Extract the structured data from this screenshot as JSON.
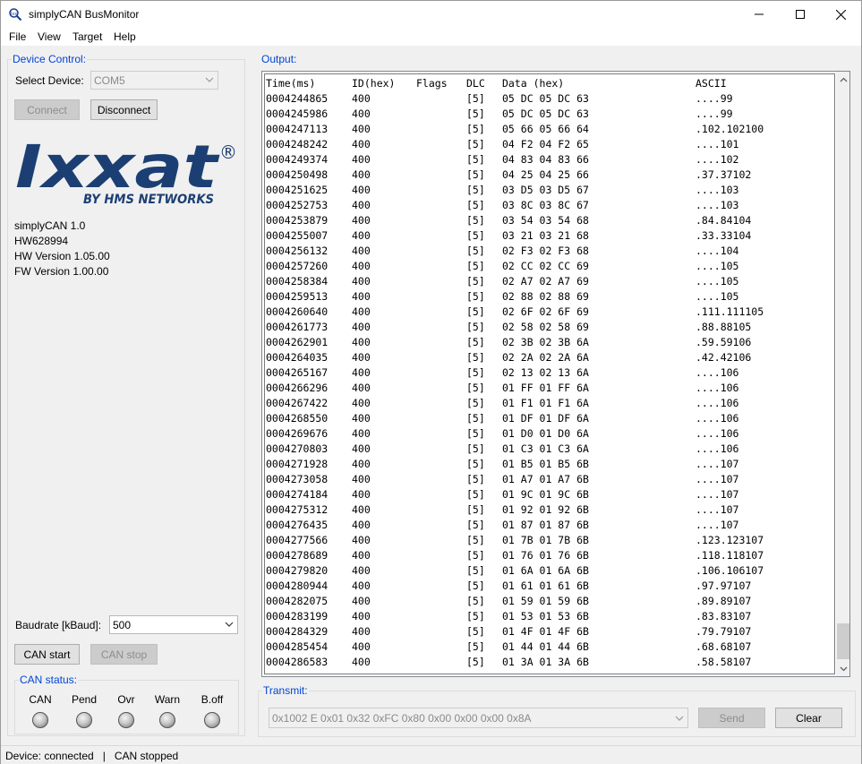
{
  "window": {
    "title": "simplyCAN BusMonitor"
  },
  "menu": [
    "File",
    "View",
    "Target",
    "Help"
  ],
  "device_control": {
    "legend": "Device Control:",
    "select_label": "Select Device:",
    "device_value": "COM5",
    "connect_label": "Connect",
    "disconnect_label": "Disconnect",
    "logo_main": "Ixxat",
    "logo_mark": "®",
    "logo_sub": "BY HMS NETWORKS",
    "info": [
      "simplyCAN 1.0",
      "HW628994",
      "HW Version 1.05.00",
      "FW Version 1.00.00"
    ],
    "baudrate_label": "Baudrate [kBaud]:",
    "baudrate_value": "500",
    "can_start_label": "CAN start",
    "can_stop_label": "CAN stop"
  },
  "can_status": {
    "legend": "CAN status:",
    "leds": [
      "CAN",
      "Pend",
      "Ovr",
      "Warn",
      "B.off"
    ]
  },
  "output": {
    "legend": "Output:",
    "columns": {
      "time": "Time(ms)",
      "id": "ID(hex)",
      "flags": "Flags",
      "dlc": "DLC",
      "data": "Data (hex)",
      "ascii": "ASCII"
    },
    "rows": [
      {
        "time": "0004244865",
        "id": "400",
        "flags": "",
        "dlc": "[5]",
        "data": "05 DC 05 DC 63",
        "ascii": "....99"
      },
      {
        "time": "0004245986",
        "id": "400",
        "flags": "",
        "dlc": "[5]",
        "data": "05 DC 05 DC 63",
        "ascii": "....99"
      },
      {
        "time": "0004247113",
        "id": "400",
        "flags": "",
        "dlc": "[5]",
        "data": "05 66 05 66 64",
        "ascii": ".102.102100"
      },
      {
        "time": "0004248242",
        "id": "400",
        "flags": "",
        "dlc": "[5]",
        "data": "04 F2 04 F2 65",
        "ascii": "....101"
      },
      {
        "time": "0004249374",
        "id": "400",
        "flags": "",
        "dlc": "[5]",
        "data": "04 83 04 83 66",
        "ascii": "....102"
      },
      {
        "time": "0004250498",
        "id": "400",
        "flags": "",
        "dlc": "[5]",
        "data": "04 25 04 25 66",
        "ascii": ".37.37102"
      },
      {
        "time": "0004251625",
        "id": "400",
        "flags": "",
        "dlc": "[5]",
        "data": "03 D5 03 D5 67",
        "ascii": "....103"
      },
      {
        "time": "0004252753",
        "id": "400",
        "flags": "",
        "dlc": "[5]",
        "data": "03 8C 03 8C 67",
        "ascii": "....103"
      },
      {
        "time": "0004253879",
        "id": "400",
        "flags": "",
        "dlc": "[5]",
        "data": "03 54 03 54 68",
        "ascii": ".84.84104"
      },
      {
        "time": "0004255007",
        "id": "400",
        "flags": "",
        "dlc": "[5]",
        "data": "03 21 03 21 68",
        "ascii": ".33.33104"
      },
      {
        "time": "0004256132",
        "id": "400",
        "flags": "",
        "dlc": "[5]",
        "data": "02 F3 02 F3 68",
        "ascii": "....104"
      },
      {
        "time": "0004257260",
        "id": "400",
        "flags": "",
        "dlc": "[5]",
        "data": "02 CC 02 CC 69",
        "ascii": "....105"
      },
      {
        "time": "0004258384",
        "id": "400",
        "flags": "",
        "dlc": "[5]",
        "data": "02 A7 02 A7 69",
        "ascii": "....105"
      },
      {
        "time": "0004259513",
        "id": "400",
        "flags": "",
        "dlc": "[5]",
        "data": "02 88 02 88 69",
        "ascii": "....105"
      },
      {
        "time": "0004260640",
        "id": "400",
        "flags": "",
        "dlc": "[5]",
        "data": "02 6F 02 6F 69",
        "ascii": ".111.111105"
      },
      {
        "time": "0004261773",
        "id": "400",
        "flags": "",
        "dlc": "[5]",
        "data": "02 58 02 58 69",
        "ascii": ".88.88105"
      },
      {
        "time": "0004262901",
        "id": "400",
        "flags": "",
        "dlc": "[5]",
        "data": "02 3B 02 3B 6A",
        "ascii": ".59.59106"
      },
      {
        "time": "0004264035",
        "id": "400",
        "flags": "",
        "dlc": "[5]",
        "data": "02 2A 02 2A 6A",
        "ascii": ".42.42106"
      },
      {
        "time": "0004265167",
        "id": "400",
        "flags": "",
        "dlc": "[5]",
        "data": "02 13 02 13 6A",
        "ascii": "....106"
      },
      {
        "time": "0004266296",
        "id": "400",
        "flags": "",
        "dlc": "[5]",
        "data": "01 FF 01 FF 6A",
        "ascii": "....106"
      },
      {
        "time": "0004267422",
        "id": "400",
        "flags": "",
        "dlc": "[5]",
        "data": "01 F1 01 F1 6A",
        "ascii": "....106"
      },
      {
        "time": "0004268550",
        "id": "400",
        "flags": "",
        "dlc": "[5]",
        "data": "01 DF 01 DF 6A",
        "ascii": "....106"
      },
      {
        "time": "0004269676",
        "id": "400",
        "flags": "",
        "dlc": "[5]",
        "data": "01 D0 01 D0 6A",
        "ascii": "....106"
      },
      {
        "time": "0004270803",
        "id": "400",
        "flags": "",
        "dlc": "[5]",
        "data": "01 C3 01 C3 6A",
        "ascii": "....106"
      },
      {
        "time": "0004271928",
        "id": "400",
        "flags": "",
        "dlc": "[5]",
        "data": "01 B5 01 B5 6B",
        "ascii": "....107"
      },
      {
        "time": "0004273058",
        "id": "400",
        "flags": "",
        "dlc": "[5]",
        "data": "01 A7 01 A7 6B",
        "ascii": "....107"
      },
      {
        "time": "0004274184",
        "id": "400",
        "flags": "",
        "dlc": "[5]",
        "data": "01 9C 01 9C 6B",
        "ascii": "....107"
      },
      {
        "time": "0004275312",
        "id": "400",
        "flags": "",
        "dlc": "[5]",
        "data": "01 92 01 92 6B",
        "ascii": "....107"
      },
      {
        "time": "0004276435",
        "id": "400",
        "flags": "",
        "dlc": "[5]",
        "data": "01 87 01 87 6B",
        "ascii": "....107"
      },
      {
        "time": "0004277566",
        "id": "400",
        "flags": "",
        "dlc": "[5]",
        "data": "01 7B 01 7B 6B",
        "ascii": ".123.123107"
      },
      {
        "time": "0004278689",
        "id": "400",
        "flags": "",
        "dlc": "[5]",
        "data": "01 76 01 76 6B",
        "ascii": ".118.118107"
      },
      {
        "time": "0004279820",
        "id": "400",
        "flags": "",
        "dlc": "[5]",
        "data": "01 6A 01 6A 6B",
        "ascii": ".106.106107"
      },
      {
        "time": "0004280944",
        "id": "400",
        "flags": "",
        "dlc": "[5]",
        "data": "01 61 01 61 6B",
        "ascii": ".97.97107"
      },
      {
        "time": "0004282075",
        "id": "400",
        "flags": "",
        "dlc": "[5]",
        "data": "01 59 01 59 6B",
        "ascii": ".89.89107"
      },
      {
        "time": "0004283199",
        "id": "400",
        "flags": "",
        "dlc": "[5]",
        "data": "01 53 01 53 6B",
        "ascii": ".83.83107"
      },
      {
        "time": "0004284329",
        "id": "400",
        "flags": "",
        "dlc": "[5]",
        "data": "01 4F 01 4F 6B",
        "ascii": ".79.79107"
      },
      {
        "time": "0004285454",
        "id": "400",
        "flags": "",
        "dlc": "[5]",
        "data": "01 44 01 44 6B",
        "ascii": ".68.68107"
      },
      {
        "time": "0004286583",
        "id": "400",
        "flags": "",
        "dlc": "[5]",
        "data": "01 3A 01 3A 6B",
        "ascii": ".58.58107"
      }
    ]
  },
  "transmit": {
    "legend": "Transmit:",
    "message_value": "0x1002 E 0x01 0x32 0xFC 0x80 0x00 0x00 0x00 0x8A",
    "send_label": "Send",
    "clear_label": "Clear"
  },
  "statusbar": {
    "text": "Device: connected   |   CAN stopped"
  }
}
